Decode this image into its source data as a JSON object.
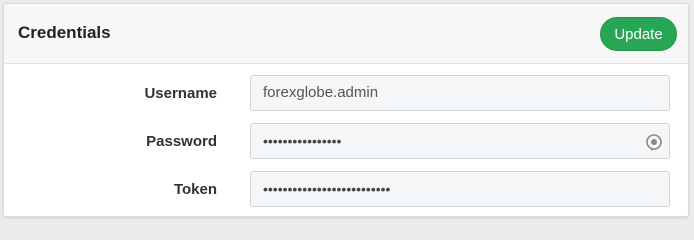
{
  "panel": {
    "title": "Credentials",
    "update_label": "Update"
  },
  "fields": {
    "username": {
      "label": "Username",
      "value": "forexglobe.admin"
    },
    "password": {
      "label": "Password",
      "value": "••••••••••••••••",
      "toggle_icon": "eye-icon"
    },
    "token": {
      "label": "Token",
      "value": "••••••••••••••••••••••••••"
    }
  },
  "colors": {
    "accent": "#28a656",
    "field_bg": "#f4f6f8"
  }
}
